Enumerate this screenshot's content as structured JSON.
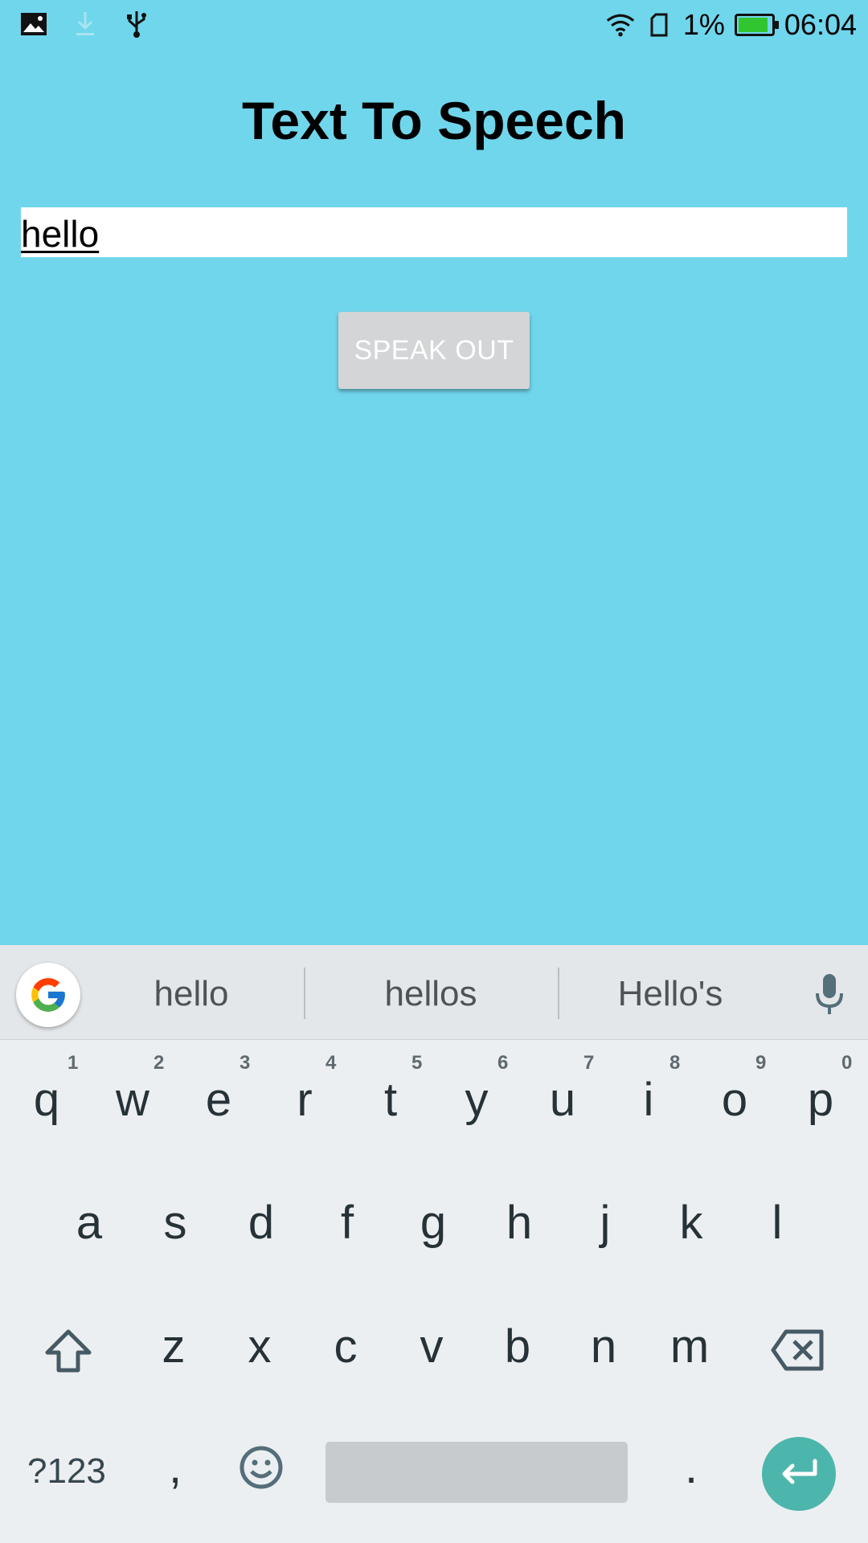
{
  "status_bar": {
    "battery_percent": "1%",
    "time": "06:04",
    "icons": [
      "image-icon",
      "download-icon",
      "usb-icon",
      "wifi-icon",
      "sim-icon",
      "battery-icon"
    ]
  },
  "app": {
    "title": "Text To Speech",
    "input_value": "hello",
    "button_label": "SPEAK OUT",
    "background_color": "#70d6ec"
  },
  "keyboard": {
    "suggestions": [
      "hello",
      "hellos",
      "Hello's"
    ],
    "row1": [
      "q",
      "w",
      "e",
      "r",
      "t",
      "y",
      "u",
      "i",
      "o",
      "p"
    ],
    "row1_hints": [
      "1",
      "2",
      "3",
      "4",
      "5",
      "6",
      "7",
      "8",
      "9",
      "0"
    ],
    "row2": [
      "a",
      "s",
      "d",
      "f",
      "g",
      "h",
      "j",
      "k",
      "l"
    ],
    "row3": [
      "z",
      "x",
      "c",
      "v",
      "b",
      "n",
      "m"
    ],
    "symbols_label": "?123",
    "comma": ",",
    "period": "."
  }
}
